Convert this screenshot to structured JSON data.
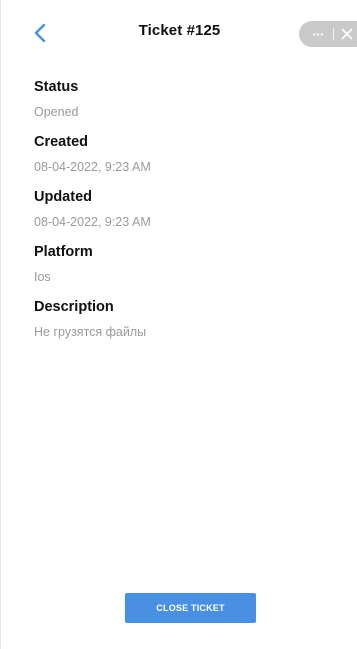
{
  "header": {
    "title": "Ticket #125",
    "back_icon": "chevron-left-icon",
    "more_icon": "more-dots-icon",
    "close_icon": "close-icon",
    "more_label": "···",
    "accent_color": "#4a90e2",
    "capsule_color": "#c9c9c9"
  },
  "details": {
    "fields": [
      {
        "label": "Status",
        "value": "Opened"
      },
      {
        "label": "Created",
        "value": "08-04-2022, 9:23 AM"
      },
      {
        "label": "Updated",
        "value": "08-04-2022, 9:23 AM"
      },
      {
        "label": "Platform",
        "value": "Ios"
      },
      {
        "label": "Description",
        "value": "Не грузятся файлы"
      }
    ]
  },
  "actions": {
    "close_ticket_label": "CLOSE TICKET",
    "button_color": "#4a90e2"
  }
}
